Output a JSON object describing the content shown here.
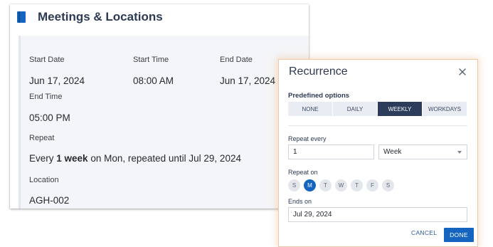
{
  "card": {
    "title": "Meetings & Locations",
    "icon": "book-icon",
    "start_date_label": "Start Date",
    "start_date_value": "Jun 17, 2024",
    "start_time_label": "Start Time",
    "start_time_value": "08:00 AM",
    "end_date_label": "End Date",
    "end_date_value": "Jun 17, 2024",
    "end_time_label": "End Time",
    "end_time_value": "05:00 PM",
    "repeat_label": "Repeat",
    "repeat_prefix": "Every ",
    "repeat_bold": "1 week",
    "repeat_suffix": " on Mon, repeated until Jul 29, 2024",
    "location_label": "Location",
    "location_value": "AGH-002"
  },
  "dialog": {
    "title": "Recurrence",
    "close_icon": "close-icon",
    "predefined_label": "Predefined options",
    "options": [
      "NONE",
      "DAILY",
      "WEEKLY",
      "WORKDAYS"
    ],
    "selected_option": "WEEKLY",
    "repeat_every_label": "Repeat every",
    "repeat_every_value": "1",
    "repeat_unit": "Week",
    "repeat_on_label": "Repeat on",
    "days": [
      "S",
      "M",
      "T",
      "W",
      "T",
      "F",
      "S"
    ],
    "selected_day_index": 1,
    "ends_on_label": "Ends on",
    "ends_on_value": "Jul 29, 2024",
    "cancel_label": "CANCEL",
    "done_label": "DONE"
  },
  "colors": {
    "primary": "#1565c0",
    "selected_segment": "#2b3d5a",
    "title_text": "#2c3a55",
    "dialog_glow": "#f1c9a8"
  }
}
